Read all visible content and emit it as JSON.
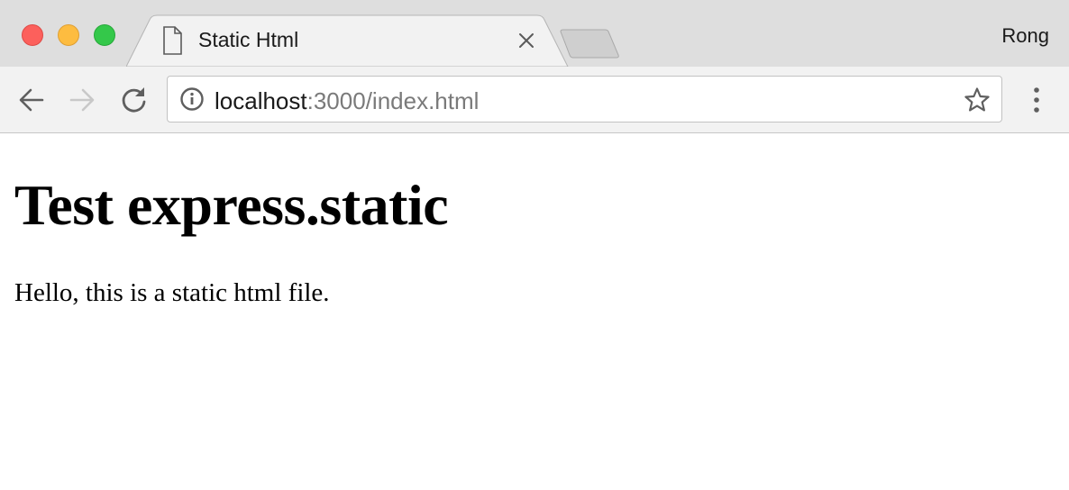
{
  "window": {
    "controls": [
      "close-button",
      "minimize-button",
      "maximize-button"
    ],
    "profile_name": "Rong"
  },
  "tabs": [
    {
      "title": "Static Html",
      "icon": "page-icon",
      "active": true,
      "close_icon": "close-icon"
    }
  ],
  "toolbar": {
    "back_icon": "arrow-left-icon",
    "forward_icon": "arrow-right-icon",
    "reload_icon": "reload-icon",
    "menu_icon": "more-vertical-icon"
  },
  "address_bar": {
    "info_icon": "info-icon",
    "url_host": "localhost",
    "url_rest": ":3000/index.html",
    "bookmark_icon": "star-icon"
  },
  "page": {
    "heading": "Test express.static",
    "paragraph": "Hello, this is a static html file."
  },
  "colors": {
    "close": "#fc605c",
    "minimize": "#fdbc40",
    "maximize": "#34c84a"
  }
}
